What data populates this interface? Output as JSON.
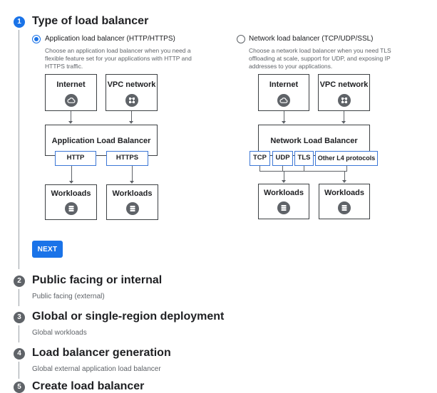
{
  "colors": {
    "accent": "#1a73e8",
    "chip_border": "#3c77d6",
    "muted": "#5f6368"
  },
  "steps": [
    {
      "number": "1",
      "title": "Type of load balancer",
      "state": "active"
    },
    {
      "number": "2",
      "title": "Public facing or internal",
      "summary": "Public facing (external)",
      "state": "inactive"
    },
    {
      "number": "3",
      "title": "Global or single-region deployment",
      "summary": "Global workloads",
      "state": "inactive"
    },
    {
      "number": "4",
      "title": "Load balancer generation",
      "summary": "Global external application load balancer",
      "state": "inactive"
    },
    {
      "number": "5",
      "title": "Create load balancer",
      "state": "inactive"
    }
  ],
  "options": [
    {
      "label": "Application load balancer (HTTP/HTTPS)",
      "selected": true,
      "description": "Choose an application load balancer when you need a flexible feature set for your applications with HTTP and HTTPS traffic.",
      "diagram": {
        "sources": [
          {
            "label": "Internet",
            "icon": "cloud-icon"
          },
          {
            "label": "VPC network",
            "icon": "network-icon"
          }
        ],
        "balancer": "Application Load Balancer",
        "protocols": [
          "HTTP",
          "HTTPS"
        ],
        "workloads": [
          {
            "label": "Workloads",
            "icon": "database-icon"
          },
          {
            "label": "Workloads",
            "icon": "database-icon"
          }
        ]
      }
    },
    {
      "label": "Network load balancer (TCP/UDP/SSL)",
      "selected": false,
      "description": "Choose a network load balancer when you need TLS offloading at scale, support for UDP, and exposing IP addresses to your applications.",
      "diagram": {
        "sources": [
          {
            "label": "Internet",
            "icon": "cloud-icon"
          },
          {
            "label": "VPC network",
            "icon": "network-icon"
          }
        ],
        "balancer": "Network Load Balancer",
        "protocols": [
          "TCP",
          "UDP",
          "TLS",
          "Other L4 protocols"
        ],
        "workloads": [
          {
            "label": "Workloads",
            "icon": "database-icon"
          },
          {
            "label": "Workloads",
            "icon": "database-icon"
          }
        ]
      }
    }
  ],
  "next_button": {
    "label": "NEXT"
  }
}
